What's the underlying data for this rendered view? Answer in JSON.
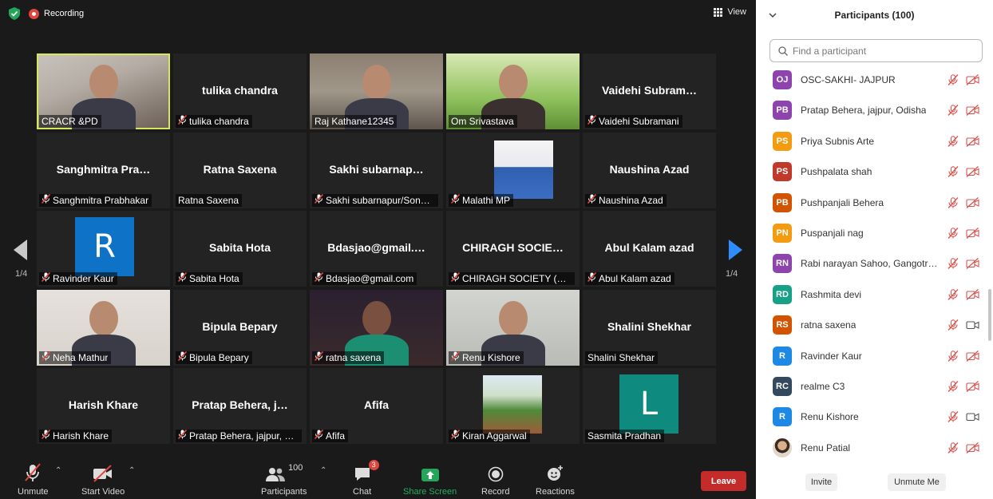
{
  "top": {
    "recording_label": "Recording",
    "view_label": "View"
  },
  "tiles": [
    {
      "label": "CRACR &PD",
      "big": "",
      "mic_off": false,
      "kind": "video",
      "bg": "vid1",
      "active": true
    },
    {
      "label": "tulika chandra",
      "big": "tulika chandra",
      "mic_off": true,
      "kind": "name"
    },
    {
      "label": "Raj Kathane12345",
      "big": "",
      "mic_off": false,
      "kind": "video",
      "bg": "vid2"
    },
    {
      "label": "Om Srivastava",
      "big": "",
      "mic_off": false,
      "kind": "video",
      "bg": "vid3"
    },
    {
      "label": "Vaidehi Subramani",
      "big": "Vaidehi  Subram…",
      "mic_off": true,
      "kind": "name"
    },
    {
      "label": "Sanghmitra Prabhakar",
      "big": "Sanghmitra  Pra…",
      "mic_off": true,
      "kind": "name"
    },
    {
      "label": "Ratna Saxena",
      "big": "Ratna Saxena",
      "mic_off": false,
      "kind": "name"
    },
    {
      "label": "Sakhi subarnapur/Sone…",
      "big": "Sakhi  subarnap…",
      "mic_off": true,
      "kind": "name"
    },
    {
      "label": "Malathi MP",
      "big": "",
      "mic_off": true,
      "kind": "photo"
    },
    {
      "label": "Naushina Azad",
      "big": "Naushina Azad",
      "mic_off": true,
      "kind": "name"
    },
    {
      "label": "Ravinder Kaur",
      "big": "",
      "mic_off": true,
      "kind": "avatar",
      "letter": "R",
      "color": "#0e72c6"
    },
    {
      "label": "Sabita Hota",
      "big": "Sabita Hota",
      "mic_off": true,
      "kind": "name"
    },
    {
      "label": "Bdasjao@gmail.com",
      "big": "Bdasjao@gmail.…",
      "mic_off": true,
      "kind": "name"
    },
    {
      "label": "CHIRAGH SOCIETY (Zafa…",
      "big": "CHIRAGH  SOCIE…",
      "mic_off": true,
      "kind": "name"
    },
    {
      "label": "Abul Kalam azad",
      "big": "Abul Kalam azad",
      "mic_off": true,
      "kind": "name"
    },
    {
      "label": "Neha Mathur",
      "big": "",
      "mic_off": true,
      "kind": "video",
      "bg": "vid4"
    },
    {
      "label": "Bipula Bepary",
      "big": "Bipula Bepary",
      "mic_off": true,
      "kind": "name"
    },
    {
      "label": "ratna saxena",
      "big": "",
      "mic_off": true,
      "kind": "video",
      "bg": "vid5"
    },
    {
      "label": "Renu Kishore",
      "big": "",
      "mic_off": true,
      "kind": "video",
      "bg": "vid6"
    },
    {
      "label": "Shalini Shekhar",
      "big": "Shalini Shekhar",
      "mic_off": false,
      "kind": "name"
    },
    {
      "label": "Harish Khare",
      "big": "Harish Khare",
      "mic_off": true,
      "kind": "name"
    },
    {
      "label": "Pratap Behera, jajpur, O…",
      "big": "Pratap  Behera,  j…",
      "mic_off": true,
      "kind": "name"
    },
    {
      "label": "Afifa",
      "big": "Afifa",
      "mic_off": true,
      "kind": "name"
    },
    {
      "label": "Kiran Aggarwal",
      "big": "",
      "mic_off": true,
      "kind": "photo2"
    },
    {
      "label": "Sasmita Pradhan",
      "big": "",
      "mic_off": false,
      "kind": "avatar",
      "letter": "L",
      "color": "#0f8a7e"
    }
  ],
  "pager": {
    "left": "1/4",
    "right": "1/4"
  },
  "toolbar": {
    "unmute": "Unmute",
    "start_video": "Start Video",
    "participants": "Participants",
    "participants_count": "100",
    "chat": "Chat",
    "chat_badge": "3",
    "share": "Share Screen",
    "record": "Record",
    "reactions": "Reactions",
    "leave": "Leave"
  },
  "panel": {
    "title": "Participants (100)",
    "search_placeholder": "Find a participant",
    "invite": "Invite",
    "unmute_me": "Unmute Me",
    "participants": [
      {
        "initials": "OJ",
        "name": "OSC-SAKHI- JAJPUR",
        "color": "#8e44ad",
        "video_on": false
      },
      {
        "initials": "PB",
        "name": "Pratap Behera, jajpur, Odisha",
        "color": "#8e44ad",
        "video_on": false
      },
      {
        "initials": "PS",
        "name": "Priya Subnis Arte",
        "color": "#f39c12",
        "video_on": false
      },
      {
        "initials": "PS",
        "name": "Pushpalata shah",
        "color": "#c0392b",
        "video_on": false
      },
      {
        "initials": "PB",
        "name": "Pushpanjali Behera",
        "color": "#d35400",
        "video_on": false
      },
      {
        "initials": "PN",
        "name": "Puspanjali nag",
        "color": "#f39c12",
        "video_on": false
      },
      {
        "initials": "RN",
        "name": "Rabi narayan Sahoo, Gangotre…",
        "color": "#8e44ad",
        "video_on": false
      },
      {
        "initials": "RD",
        "name": "Rashmita devi",
        "color": "#16a085",
        "video_on": false
      },
      {
        "initials": "RS",
        "name": "ratna saxena",
        "color": "#d35400",
        "video_on": true
      },
      {
        "initials": "R",
        "name": "Ravinder Kaur",
        "color": "#1e88e5",
        "video_on": false
      },
      {
        "initials": "RC",
        "name": "realme C3",
        "color": "#34495e",
        "video_on": false
      },
      {
        "initials": "R",
        "name": "Renu Kishore",
        "color": "#1e88e5",
        "video_on": true
      },
      {
        "initials": "",
        "name": "Renu Patial",
        "color": "#b08a6a",
        "video_on": false,
        "photo": true
      }
    ]
  }
}
